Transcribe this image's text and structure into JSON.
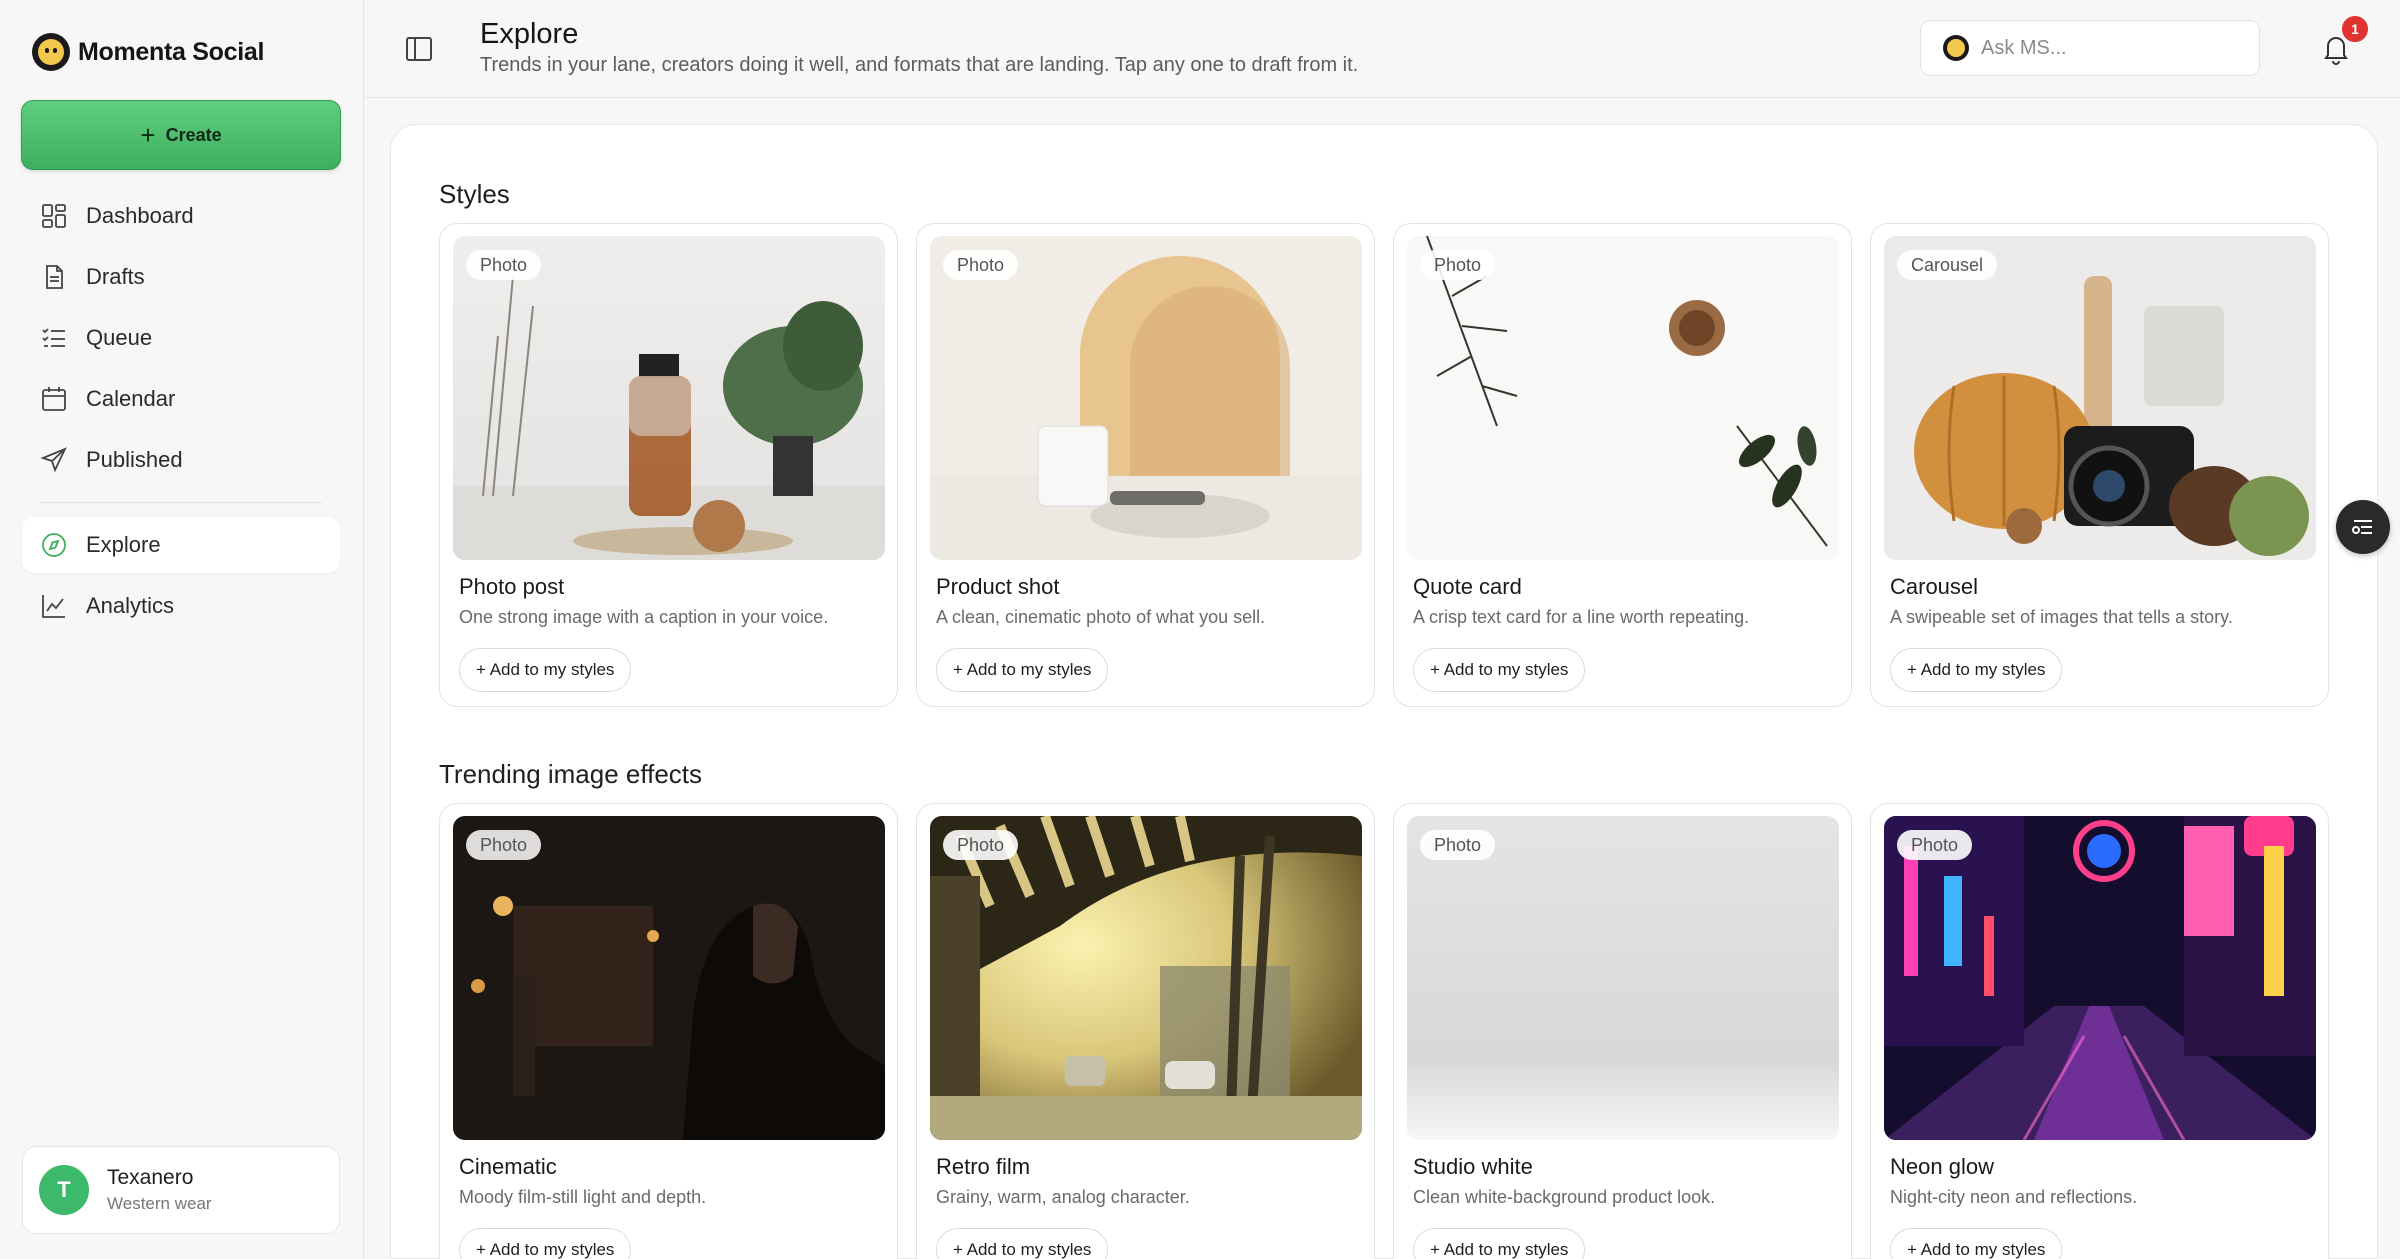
{
  "brand": {
    "name": "Momenta Social"
  },
  "sidebar": {
    "create_label": "Create",
    "items": [
      {
        "label": "Dashboard",
        "icon": "dashboard-icon"
      },
      {
        "label": "Drafts",
        "icon": "document-icon"
      },
      {
        "label": "Queue",
        "icon": "checklist-icon"
      },
      {
        "label": "Calendar",
        "icon": "calendar-icon"
      },
      {
        "label": "Published",
        "icon": "send-icon"
      },
      {
        "label": "Explore",
        "icon": "compass-icon",
        "active": true
      },
      {
        "label": "Analytics",
        "icon": "line-chart-icon"
      }
    ],
    "user": {
      "initial": "T",
      "name": "Texanero",
      "subtitle": "Western wear"
    }
  },
  "header": {
    "title": "Explore",
    "subtitle": "Trends in your lane, creators doing it well, and formats that are landing. Tap any one to draft from it.",
    "ask_placeholder": "Ask MS...",
    "notifications": "1"
  },
  "sections": [
    {
      "title": "Styles",
      "cards": [
        {
          "tag": "Photo",
          "title": "Photo post",
          "desc": "One strong image with a caption in your voice.",
          "button": "+ Add to my styles"
        },
        {
          "tag": "Photo",
          "title": "Product shot",
          "desc": "A clean, cinematic photo of what you sell.",
          "button": "+ Add to my styles"
        },
        {
          "tag": "Photo",
          "title": "Quote card",
          "desc": "A crisp text card for a line worth repeating.",
          "button": "+ Add to my styles"
        },
        {
          "tag": "Carousel",
          "title": "Carousel",
          "desc": "A swipeable set of images that tells a story.",
          "button": "+ Add to my styles"
        }
      ]
    },
    {
      "title": "Trending image effects",
      "cards": [
        {
          "tag": "Photo",
          "title": "Cinematic",
          "desc": "Moody film-still light and depth.",
          "button": "+ Add to my styles"
        },
        {
          "tag": "Photo",
          "title": "Retro film",
          "desc": "Grainy, warm, analog character.",
          "button": "+ Add to my styles"
        },
        {
          "tag": "Photo",
          "title": "Studio white",
          "desc": "Clean white-background product look.",
          "button": "+ Add to my styles"
        },
        {
          "tag": "Photo",
          "title": "Neon glow",
          "desc": "Night-city neon and reflections.",
          "button": "+ Add to my styles"
        }
      ]
    }
  ],
  "colors": {
    "accent": "#3fae5f",
    "badge": "#e0322f"
  }
}
